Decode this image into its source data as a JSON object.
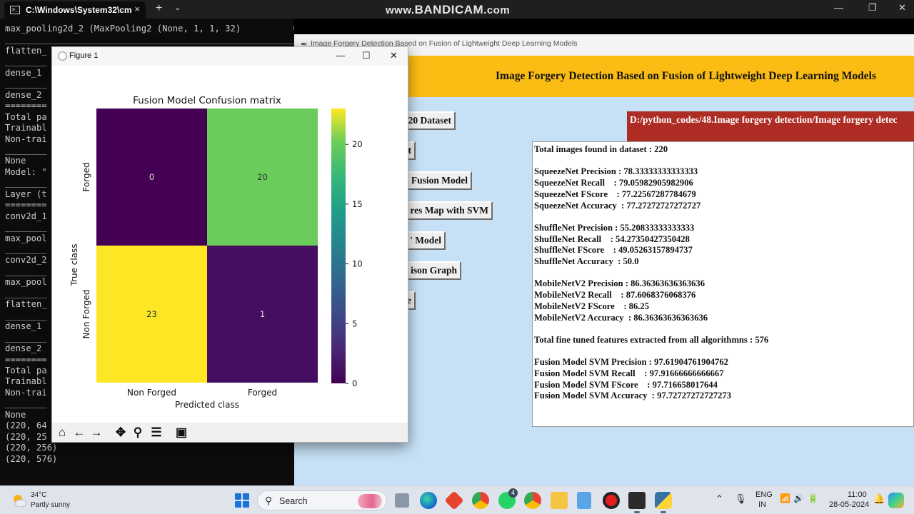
{
  "terminal": {
    "tab_title": "C:\\Windows\\System32\\cm",
    "tab_close": "×",
    "tab_add": "+",
    "tab_menu": "⌄",
    "lines": [
      "max_pooling2d_2 (MaxPooling2 (None, 1, 1, 32)          0",
      "________________________________________________________________",
      "flatten_",
      "________",
      "dense_1",
      "________",
      "dense_2",
      "========",
      "Total pa",
      "Trainabl",
      "Non-trai",
      "________",
      "None",
      "Model: \"",
      "________",
      "Layer (t",
      "========",
      "conv2d_1",
      "________",
      "max_pool",
      "________",
      "conv2d_2",
      "________",
      "max_pool",
      "________",
      "flatten_",
      "________",
      "dense_1",
      "________",
      "dense_2",
      "========",
      "Total pa",
      "Trainabl",
      "Non-trai",
      "________",
      "None",
      "(220, 64",
      "(220, 25",
      "(220, 256)",
      "(220, 576)"
    ]
  },
  "recorder_watermark": {
    "prefix": "www.",
    "brand": "BANDICAM",
    "suffix": ".com"
  },
  "app": {
    "window_title": "Image Forgery Detection Based on Fusion of Lightweight Deep Learning Models",
    "header": "Image Forgery Detection Based on Fusion of Lightweight Deep Learning Models",
    "buttons": [
      "20 Dataset",
      "t",
      "Fusion Model",
      "res Map with SVM",
      "' Model",
      "ison Graph",
      "e"
    ],
    "dataset_path": "D:/python_codes/48.Image forgery detection/Image forgery detec",
    "output_lines": [
      "Total images found in dataset : 220",
      "",
      "SqueezeNet Precision : 78.33333333333333",
      "SqueezeNet Recall    : 79.05982905982906",
      "SqueezeNet FScore    : 77.22567287784679",
      "SqueezeNet Accuracy  : 77.27272727272727",
      "",
      "ShuffleNet Precision : 55.20833333333333",
      "ShuffleNet Recall    : 54.27350427350428",
      "ShuffleNet FScore    : 49.05263157894737",
      "ShuffleNet Accuracy  : 50.0",
      "",
      "MobileNetV2 Precision : 86.36363636363636",
      "MobileNetV2 Recall    : 87.6068376068376",
      "MobileNetV2 FScore    : 86.25",
      "MobileNetV2 Accuracy  : 86.36363636363636",
      "",
      "Total fine tuned features extracted from all algorithmns : 576",
      "",
      "Fusion Model SVM Precision : 97.61904761904762",
      "Fusion Model SVM Recall    : 97.91666666666667",
      "Fusion Model SVM FScore    : 97.716658017644",
      "Fusion Model SVM Accuracy  : 97.72727272727273"
    ]
  },
  "figure": {
    "window_title": "Figure 1",
    "minimize": "—",
    "maximize": "☐",
    "close": "✕"
  },
  "chart_data": {
    "type": "heatmap",
    "title": "Fusion Model Confusion matrix",
    "xlabel": "Predicted class",
    "ylabel": "True class",
    "x_categories": [
      "Non Forged",
      "Forged"
    ],
    "y_categories": [
      "Forged",
      "Non Forged"
    ],
    "values": [
      [
        0,
        20
      ],
      [
        23,
        1
      ]
    ],
    "colormap": "viridis",
    "colorbar": {
      "min": 0,
      "max": 23,
      "ticks": [
        0,
        5,
        10,
        15,
        20
      ]
    }
  },
  "taskbar": {
    "weather_temp": "34°C",
    "weather_desc": "Partly sunny",
    "search_label": "Search",
    "whatsapp_badge": "4",
    "language_top": "ENG",
    "language_bottom": "IN",
    "time": "11:00",
    "date": "28-05-2024"
  }
}
